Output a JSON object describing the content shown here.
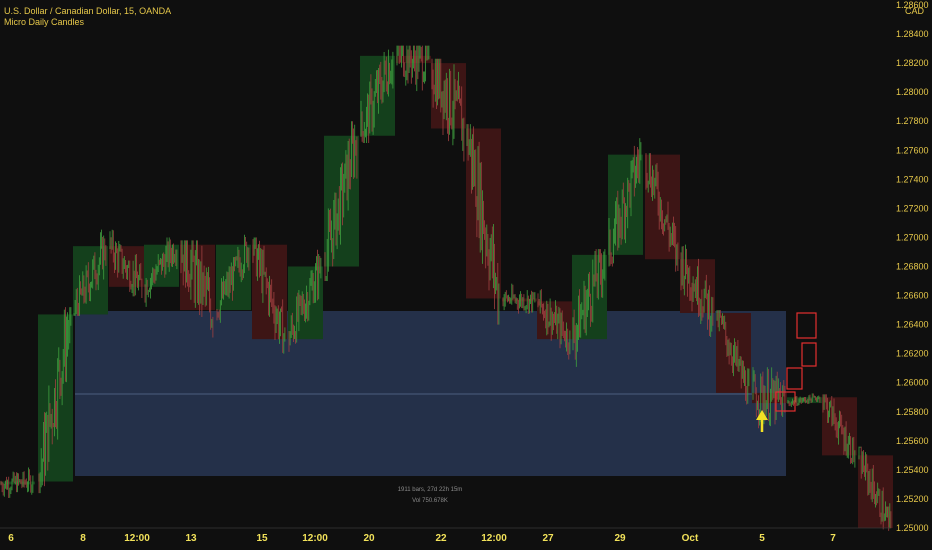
{
  "header": {
    "title": "U.S. Dollar / Canadian Dollar, 15, OANDA",
    "indicator": "Micro Daily Candles"
  },
  "axis": {
    "currency": "CAD",
    "y_ticks": [
      "1.28600",
      "1.28400",
      "1.28200",
      "1.28000",
      "1.27800",
      "1.27600",
      "1.27400",
      "1.27200",
      "1.27000",
      "1.26800",
      "1.26600",
      "1.26400",
      "1.26200",
      "1.26000",
      "1.25800",
      "1.25600",
      "1.25400",
      "1.25200",
      "1.25000"
    ],
    "x_ticks": [
      "6",
      "8",
      "12:00",
      "13",
      "15",
      "12:00",
      "20",
      "22",
      "12:00",
      "27",
      "29",
      "Oct",
      "5",
      "7"
    ]
  },
  "range_box": {
    "line1": "1911 bars, 27d 22h 15m",
    "line2": "Vol 750.678K"
  },
  "colors": {
    "background": "#0f0f0f",
    "up_box": "#14401c",
    "down_box": "#3d1515",
    "up_wick": "#3fa03f",
    "down_wick": "#a04040",
    "range_fill": "#2a3a5a",
    "range_line": "#5a6e92",
    "highlight_box": "#e23030",
    "arrow": "#f2e025",
    "text_yellow": "#e6c84a"
  },
  "chart_data": {
    "type": "candlestick",
    "timeframe": "15",
    "symbol": "USDCAD",
    "ylim": [
      1.25,
      1.286
    ],
    "daily_candles": [
      {
        "open": 1.253,
        "close": 1.2532,
        "high": 1.2556,
        "low": 1.252
      },
      {
        "open": 1.2532,
        "close": 1.2647,
        "high": 1.2652,
        "low": 1.2524
      },
      {
        "open": 1.2647,
        "close": 1.2694,
        "high": 1.2716,
        "low": 1.2646
      },
      {
        "open": 1.2694,
        "close": 1.2666,
        "high": 1.2708,
        "low": 1.2648
      },
      {
        "open": 1.2666,
        "close": 1.2695,
        "high": 1.27,
        "low": 1.2645
      },
      {
        "open": 1.2695,
        "close": 1.265,
        "high": 1.2698,
        "low": 1.259
      },
      {
        "open": 1.265,
        "close": 1.2695,
        "high": 1.2702,
        "low": 1.264
      },
      {
        "open": 1.2695,
        "close": 1.263,
        "high": 1.27,
        "low": 1.262
      },
      {
        "open": 1.263,
        "close": 1.268,
        "high": 1.2695,
        "low": 1.262
      },
      {
        "open": 1.268,
        "close": 1.277,
        "high": 1.278,
        "low": 1.267
      },
      {
        "open": 1.277,
        "close": 1.2825,
        "high": 1.2858,
        "low": 1.2765
      },
      {
        "open": 1.2825,
        "close": 1.282,
        "high": 1.2832,
        "low": 1.2755
      },
      {
        "open": 1.282,
        "close": 1.2775,
        "high": 1.2823,
        "low": 1.2705
      },
      {
        "open": 1.2775,
        "close": 1.2658,
        "high": 1.2778,
        "low": 1.264
      },
      {
        "open": 1.2658,
        "close": 1.2656,
        "high": 1.267,
        "low": 1.2632
      },
      {
        "open": 1.2656,
        "close": 1.263,
        "high": 1.267,
        "low": 1.2612
      },
      {
        "open": 1.263,
        "close": 1.2688,
        "high": 1.2692,
        "low": 1.2592
      },
      {
        "open": 1.2688,
        "close": 1.2757,
        "high": 1.2772,
        "low": 1.268
      },
      {
        "open": 1.2757,
        "close": 1.2685,
        "high": 1.2758,
        "low": 1.2675
      },
      {
        "open": 1.2685,
        "close": 1.2648,
        "high": 1.27,
        "low": 1.262
      },
      {
        "open": 1.2648,
        "close": 1.2593,
        "high": 1.265,
        "low": 1.2585
      },
      {
        "open": 1.2593,
        "close": 1.2586,
        "high": 1.264,
        "low": 1.2558
      },
      {
        "open": 1.2586,
        "close": 1.259,
        "high": 1.2594,
        "low": 1.258
      },
      {
        "open": 1.259,
        "close": 1.255,
        "high": 1.2592,
        "low": 1.254
      },
      {
        "open": 1.255,
        "close": 1.25,
        "high": 1.2556,
        "low": 1.2498
      }
    ]
  }
}
